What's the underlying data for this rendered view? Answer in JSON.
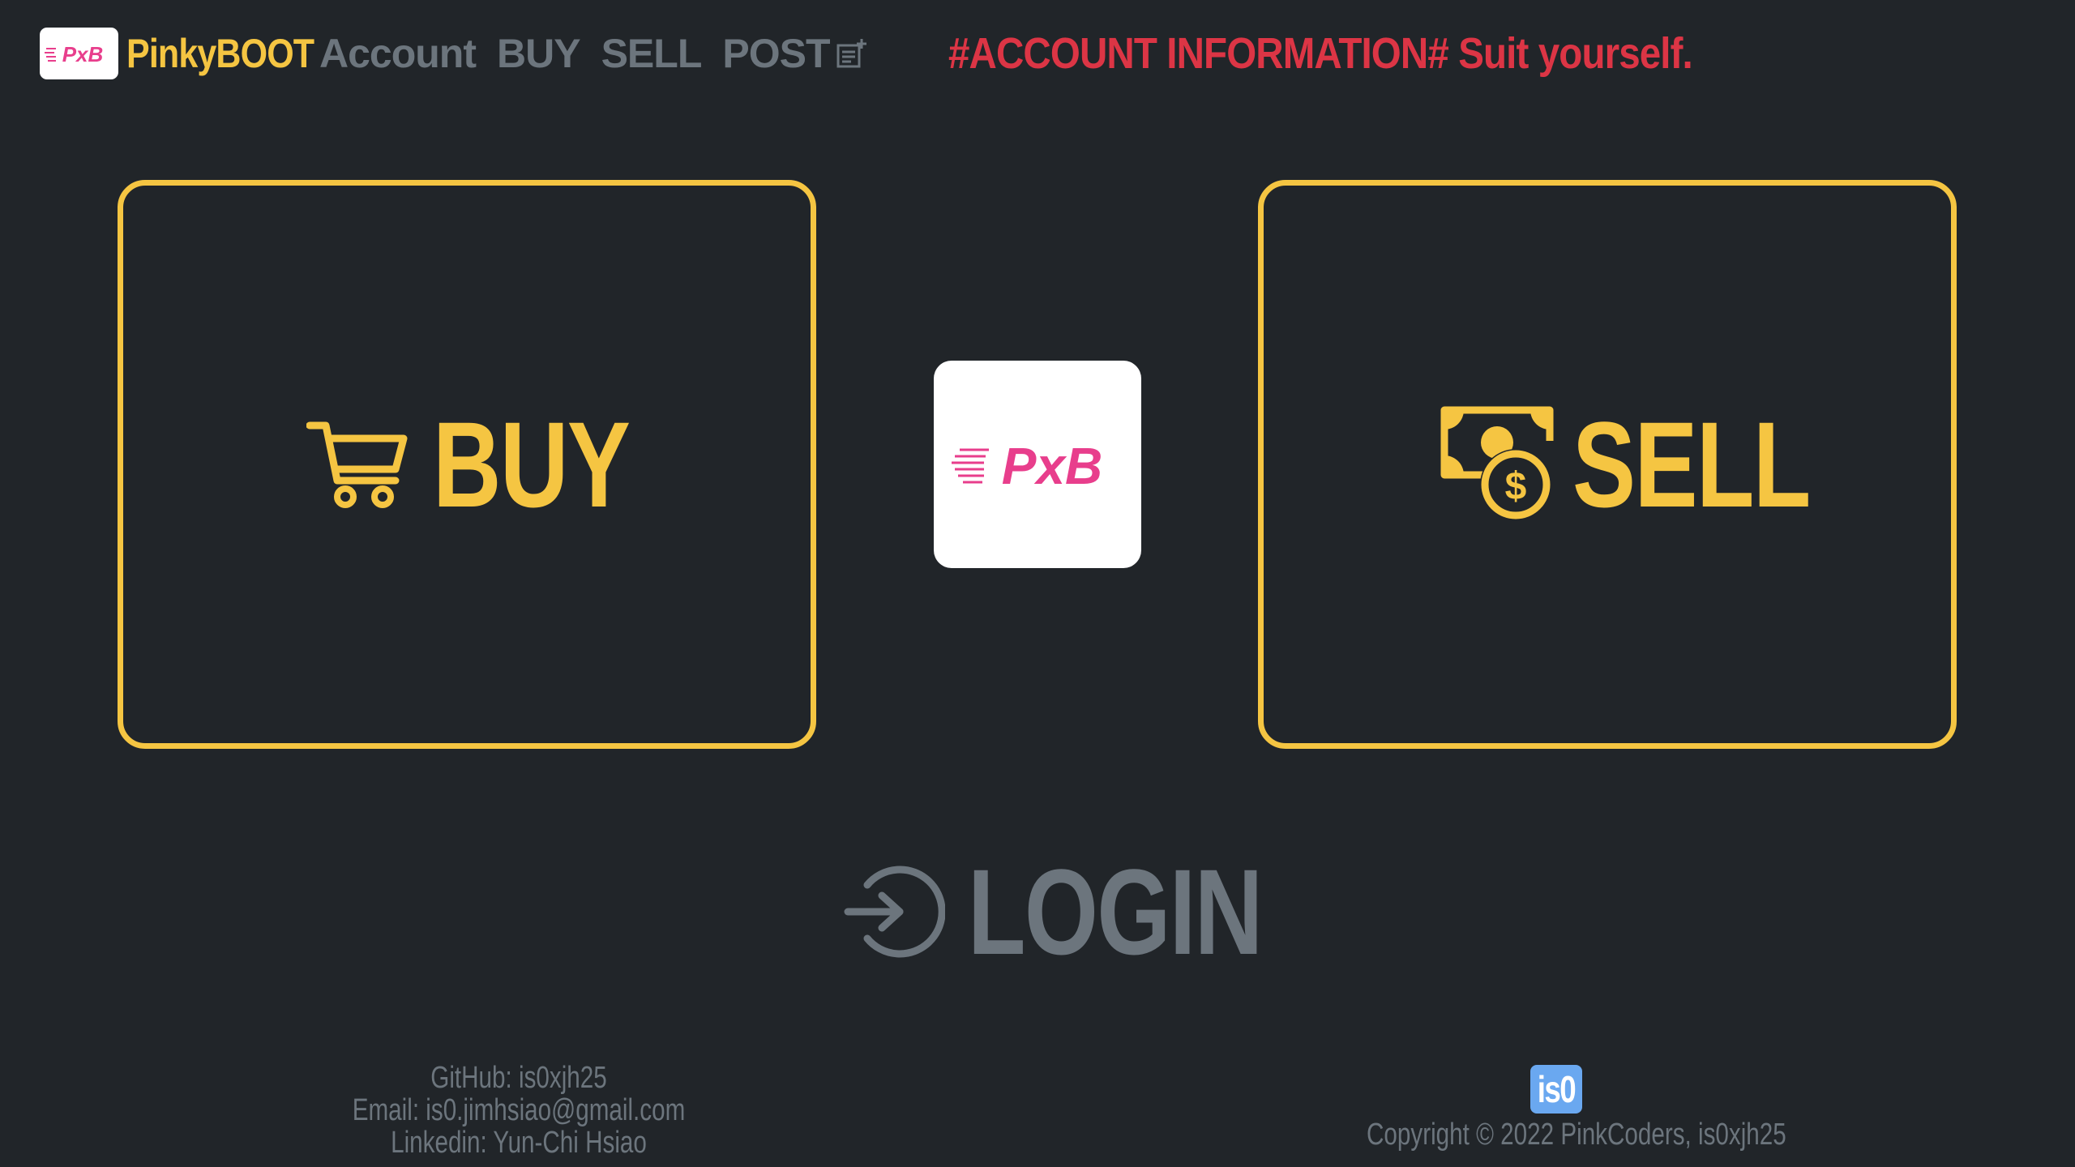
{
  "navbar": {
    "brand_logo_text": "PxB",
    "brand_name": "PinkyBOOT",
    "links": [
      "Account",
      "BUY",
      "SELL",
      "POST"
    ],
    "headline": "#ACCOUNT INFORMATION# Suit yourself."
  },
  "main": {
    "buy_label": "BUY",
    "sell_label": "SELL",
    "center_logo_text": "PxB",
    "login_label": "LOGIN"
  },
  "footer": {
    "github": "GitHub: is0xjh25",
    "email": "Email: is0.jimhsiao@gmail.com",
    "linkedin": "Linkedin: Yun-Chi Hsiao",
    "badge": "is0",
    "copyright": "Copyright © 2022 PinkCoders, is0xjh25"
  },
  "colors": {
    "background": "#212529",
    "accent_yellow": "#f5c542",
    "accent_pink": "#e83e8c",
    "headline_red": "#dc3545",
    "muted_gray": "#6c757d",
    "badge_blue": "#6aa8f0"
  },
  "icons": {
    "cart": "shopping-cart-icon",
    "money": "cash-coin-icon",
    "login": "login-arrow-icon",
    "post": "post-add-icon"
  }
}
